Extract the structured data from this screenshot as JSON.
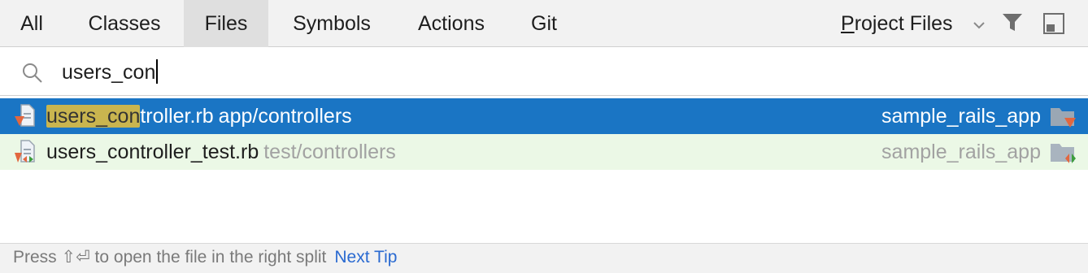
{
  "tabs": [
    {
      "label": "All",
      "selected": false
    },
    {
      "label": "Classes",
      "selected": false
    },
    {
      "label": "Files",
      "selected": true
    },
    {
      "label": "Symbols",
      "selected": false
    },
    {
      "label": "Actions",
      "selected": false
    },
    {
      "label": "Git",
      "selected": false
    }
  ],
  "scope": {
    "mnemonic": "P",
    "rest": "roject Files",
    "dropdown_icon": "chevron-down-icon",
    "filter_icon": "filter-icon",
    "pin_icon": "pin-window-icon"
  },
  "search": {
    "icon": "search-icon",
    "value": "users_con"
  },
  "results": [
    {
      "match": "users_con",
      "rest": "troller.rb",
      "path": "app/controllers",
      "module": "sample_rails_app",
      "selected": true,
      "icon": "ruby-controller-file-icon",
      "module_icon": "module-folder-icon"
    },
    {
      "match": "",
      "rest": "users_controller_test.rb",
      "path": "test/controllers",
      "module": "sample_rails_app",
      "selected": false,
      "icon": "ruby-test-file-icon",
      "module_icon": "test-module-folder-icon"
    }
  ],
  "footer": {
    "hint": "Press ⇧⏎ to open the file in the right split",
    "next_tip": "Next Tip"
  },
  "colors": {
    "selection": "#1a75c4",
    "test_row": "#ebf8e6",
    "match_highlight": "#c9b54f",
    "link": "#2a6ad1"
  }
}
